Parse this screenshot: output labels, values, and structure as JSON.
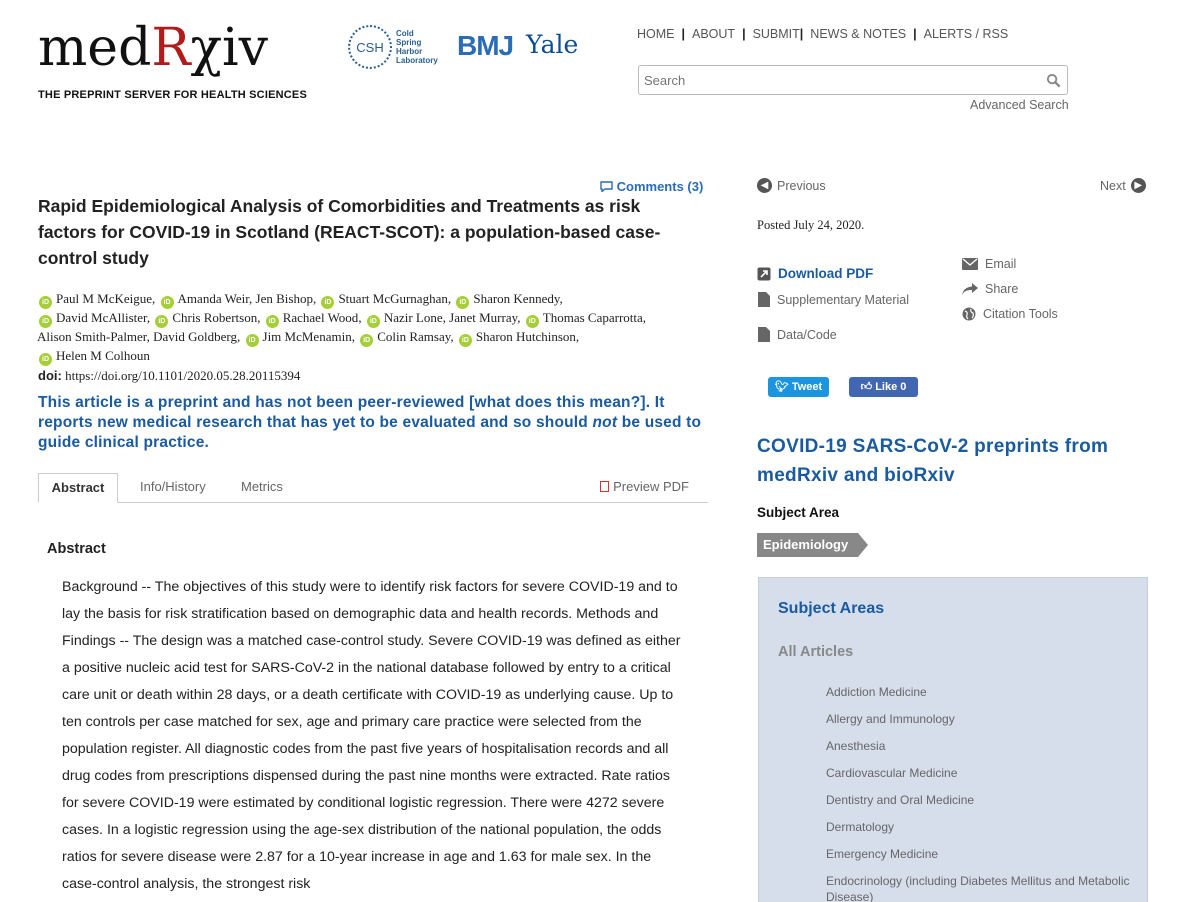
{
  "header": {
    "logo_prefix": "med",
    "logo_r": "R",
    "logo_suffix": "χiv",
    "tagline": "THE PREPRINT SERVER FOR HEALTH SCIENCES",
    "partners": {
      "csh_initials": "CSH",
      "csh_line1": "Cold",
      "csh_line2": "Spring",
      "csh_line3": "Harbor",
      "csh_line4": "Laboratory",
      "bmj": "BMJ",
      "yale": "Yale"
    },
    "nav": [
      "HOME",
      "ABOUT",
      "SUBMIT",
      "NEWS & NOTES",
      "ALERTS / RSS"
    ],
    "search_placeholder": "Search",
    "advanced_search": "Advanced Search"
  },
  "article": {
    "comments": "Comments (3)",
    "title": "Rapid Epidemiological Analysis of Comorbidities and Treatments as risk factors for COVID-19 in Scotland (REACT-SCOT): a population-based case-control study",
    "authors": [
      {
        "name": "Paul M McKeigue",
        "orcid": true
      },
      {
        "name": "Amanda Weir",
        "orcid": true
      },
      {
        "name": "Jen Bishop",
        "orcid": false
      },
      {
        "name": "Stuart McGurnaghan",
        "orcid": true
      },
      {
        "name": "Sharon Kennedy",
        "orcid": true
      },
      {
        "name": "David McAllister",
        "orcid": true
      },
      {
        "name": "Chris Robertson",
        "orcid": true
      },
      {
        "name": "Rachael Wood",
        "orcid": true
      },
      {
        "name": "Nazir Lone",
        "orcid": true
      },
      {
        "name": "Janet Murray",
        "orcid": false
      },
      {
        "name": "Thomas Caparrotta",
        "orcid": true
      },
      {
        "name": "Alison Smith-Palmer",
        "orcid": false
      },
      {
        "name": "David Goldberg",
        "orcid": false
      },
      {
        "name": "Jim McMenamin",
        "orcid": true
      },
      {
        "name": "Colin Ramsay",
        "orcid": true
      },
      {
        "name": "Sharon Hutchinson",
        "orcid": true
      },
      {
        "name": "Helen M Colhoun",
        "orcid": true
      }
    ],
    "doi_label": "doi:",
    "doi": "https://doi.org/10.1101/2020.05.28.20115394",
    "notice_part1": "This article is a preprint and has not been peer-reviewed [what does this mean?]. It reports new medical research that has yet to be evaluated and so should ",
    "notice_not": "not",
    "notice_part2": " be used to guide clinical practice.",
    "tabs": {
      "abstract": "Abstract",
      "info": "Info/History",
      "metrics": "Metrics",
      "preview": "Preview PDF"
    },
    "abstract_heading": "Abstract",
    "abstract_text": "Background -- The objectives of this study were to identify risk factors for severe COVID-19 and to lay the basis for risk stratification based on demographic data and health records. Methods and Findings -- The design was a matched case-control study. Severe COVID-19 was defined as either a positive nucleic acid test for SARS-CoV-2 in the national database followed by entry to a critical care unit or death within 28 days, or a death certificate with COVID-19 as underlying cause. Up to ten controls per case matched for sex, age and primary care practice were selected from the population register. All diagnostic codes from the past five years of hospitalisation records and all drug codes from prescriptions dispensed during the past nine months were extracted. Rate ratios for severe COVID-19 were estimated by conditional logistic regression. There were 4272 severe cases. In a logistic regression using the age-sex distribution of the national population, the odds ratios for severe disease were 2.87 for a 10-year increase in age and 1.63 for male sex. In the case-control analysis, the strongest risk"
  },
  "sidebar": {
    "previous": "Previous",
    "next": "Next",
    "posted": "Posted July 24, 2020.",
    "download_pdf": "Download PDF",
    "supplementary": "Supplementary Material",
    "data_code": "Data/Code",
    "email": "Email",
    "share": "Share",
    "citation_tools": "Citation Tools",
    "tweet": "Tweet",
    "like": "Like 0",
    "covid_link": "COVID-19 SARS-CoV-2 preprints from medRxiv and bioRxiv",
    "subject_area_label": "Subject Area",
    "subject_tag": "Epidemiology",
    "panel_title": "Subject Areas",
    "panel_all": "All Articles",
    "subjects": [
      "Addiction Medicine",
      "Allergy and Immunology",
      "Anesthesia",
      "Cardiovascular Medicine",
      "Dentistry and Oral Medicine",
      "Dermatology",
      "Emergency Medicine",
      "Endocrinology (including Diabetes Mellitus and Metabolic Disease)"
    ]
  },
  "colors": {
    "link_blue": "#1a5aa0",
    "orcid_green": "#a6ce39",
    "logo_red": "#b31b1b",
    "panel_bg": "#d6deeb"
  }
}
